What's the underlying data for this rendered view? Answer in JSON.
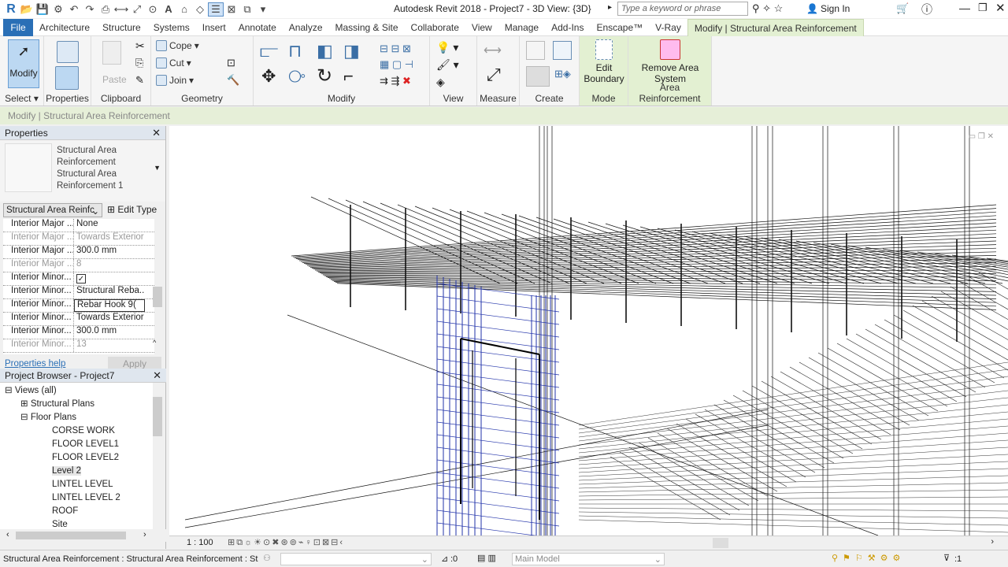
{
  "app": {
    "title": "Autodesk Revit 2018 -   Project7 - 3D View: {3D}",
    "search_placeholder": "Type a keyword or phrase",
    "sign_in": "Sign In"
  },
  "tabs": [
    "File",
    "Architecture",
    "Structure",
    "Systems",
    "Insert",
    "Annotate",
    "Analyze",
    "Massing & Site",
    "Collaborate",
    "View",
    "Manage",
    "Add-Ins",
    "Enscape™",
    "V-Ray",
    "Modify | Structural Area Reinforcement"
  ],
  "ribbon": {
    "modify": "Modify",
    "select": "Select ▾",
    "properties": "Properties",
    "paste": "Paste",
    "clipboard": "Clipboard",
    "cope": "Cope",
    "cut": "Cut",
    "join": "Join",
    "geometry": "Geometry",
    "modify_panel": "Modify",
    "view_panel": "View",
    "measure_panel": "Measure",
    "create_panel": "Create",
    "edit_boundary": "Edit Boundary",
    "mode_panel": "Mode",
    "remove_area_system": "Remove Area System",
    "area_reinforcement_panel": "Area Reinforcement"
  },
  "context_bar": "Modify | Structural Area Reinforcement",
  "properties": {
    "title": "Properties",
    "type_line1": "Structural Area Reinforcement",
    "type_line2": "Structural Area Reinforcement 1",
    "filter": "Structural Area Reinfc",
    "edit_type": "Edit Type",
    "rows": [
      {
        "k": "Interior Major ...",
        "v": "None",
        "dim": false
      },
      {
        "k": "Interior Major ...",
        "v": "Towards Exterior",
        "dim": true
      },
      {
        "k": "Interior Major ...",
        "v": "300.0 mm",
        "dim": false
      },
      {
        "k": "Interior Major ...",
        "v": "8",
        "dim": true
      },
      {
        "k": "Interior Minor...",
        "v": "",
        "checkbox": true,
        "dim": false
      },
      {
        "k": "Interior Minor...",
        "v": "Structural Reba...",
        "dim": false
      },
      {
        "k": "Interior Minor...",
        "v": "Rebar Hook 9(",
        "editing": true,
        "dim": false
      },
      {
        "k": "Interior Minor...",
        "v": "Towards Exterior",
        "dim": false
      },
      {
        "k": "Interior Minor...",
        "v": "300.0 mm",
        "dim": false
      },
      {
        "k": "Interior Minor...",
        "v": "13",
        "dim": true
      }
    ],
    "help": "Properties help",
    "apply": "Apply"
  },
  "browser": {
    "title": "Project Browser - Project7",
    "items": [
      {
        "label": "Views (all)",
        "level": 0,
        "toggle": "⊟"
      },
      {
        "label": "Structural Plans",
        "level": 1,
        "toggle": "⊞"
      },
      {
        "label": "Floor Plans",
        "level": 1,
        "toggle": "⊟"
      },
      {
        "label": "CORSE WORK",
        "level": 2
      },
      {
        "label": "FLOOR LEVEL1",
        "level": 2
      },
      {
        "label": "FLOOR LEVEL2",
        "level": 2
      },
      {
        "label": "Level 2",
        "level": 2,
        "selected": true
      },
      {
        "label": "LINTEL LEVEL",
        "level": 2
      },
      {
        "label": "LINTEL LEVEL 2",
        "level": 2
      },
      {
        "label": "ROOF",
        "level": 2
      },
      {
        "label": "Site",
        "level": 2
      }
    ]
  },
  "viewbar": {
    "scale": "1 : 100"
  },
  "status": {
    "text": "Structural Area Reinforcement : Structural Area Reinforcement : St",
    "count": ":0",
    "model": "Main Model",
    "filter_count": ":1"
  },
  "colors": {
    "file_tab": "#2a6fb6",
    "context": "#e6efd8",
    "selection": "#2233aa"
  }
}
